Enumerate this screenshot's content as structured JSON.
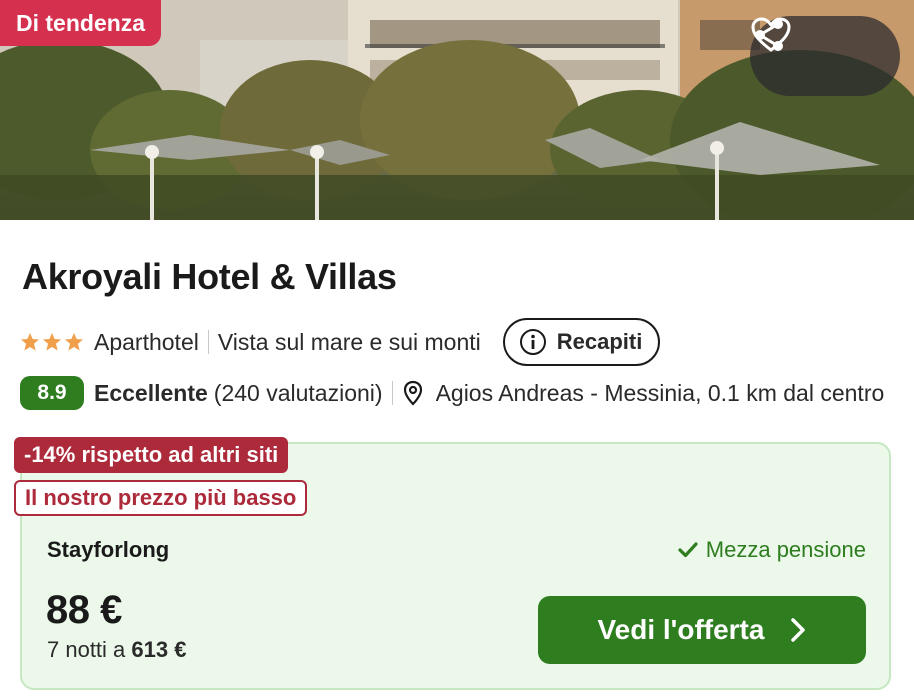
{
  "hero": {
    "badge": "Di tendenza",
    "icons": {
      "share": "share-icon",
      "favorite": "heart-icon"
    }
  },
  "hotel": {
    "name": "Akroyali Hotel & Villas",
    "stars": 3,
    "type": "Aparthotel",
    "feature": "Vista sul mare e sui monti",
    "contacts_label": "Recapiti",
    "rating": "8.9",
    "rating_word": "Eccellente",
    "reviews": "(240 valutazioni)",
    "location": "Agios Andreas - Messinia, 0.1 km dal centro"
  },
  "offer": {
    "discount_tag": "-14% rispetto ad altri siti",
    "lowest_tag": "Il nostro prezzo più basso",
    "provider": "Stayforlong",
    "board": "Mezza pensione",
    "price": "88 €",
    "nights_prefix": "7 notti a",
    "total": "613 €",
    "cta": "Vedi l'offerta"
  },
  "colors": {
    "trend_badge": "#d6304f",
    "rating_green": "#2e7d1f",
    "discount_red": "#ac2a3a",
    "card_bg": "#ebf8ea",
    "star": "#f0a04b"
  }
}
